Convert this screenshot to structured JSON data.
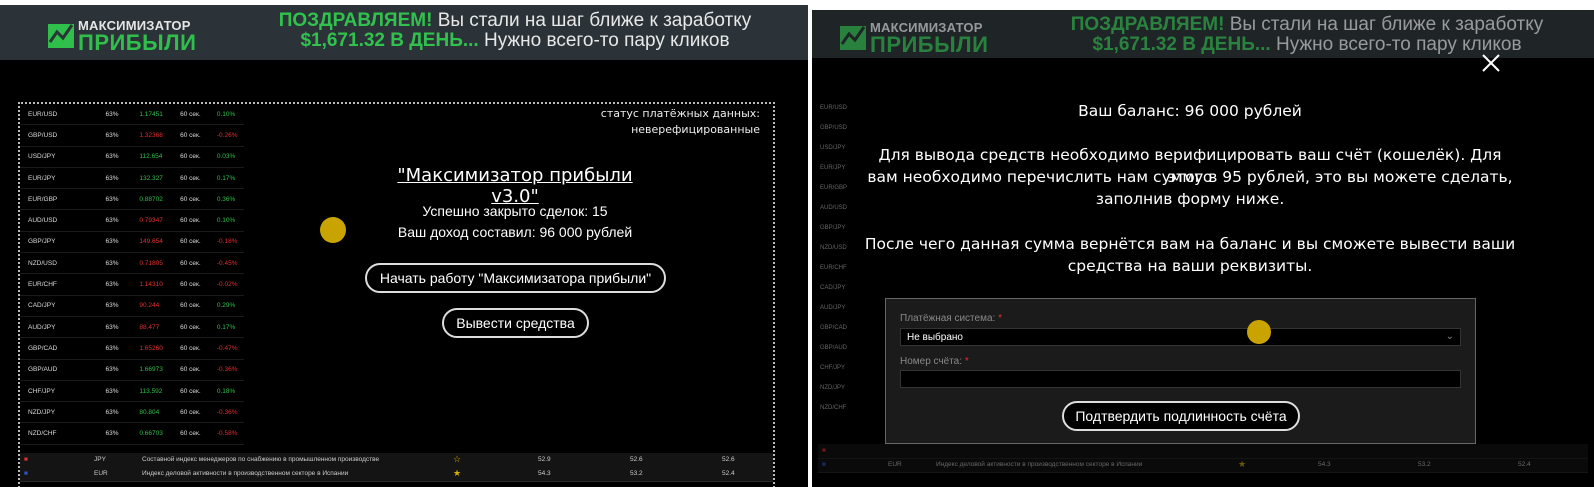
{
  "banner": {
    "logo_line1": "МАКСИМИЗАТОР",
    "logo_line2": "ПРИБЫЛИ",
    "headline_green1": "ПОЗДРАВЛЯЕМ!",
    "headline_white1": " Вы стали на шаг ближе к заработку",
    "headline_green2": "$1,671.32 В ДЕНЬ...",
    "headline_white2": " Нужно всего-то пару кликов"
  },
  "ticker": [
    {
      "pair": "EUR/USD",
      "pct": "63%",
      "value": "1.17451",
      "dur": "60 сек.",
      "change": "0.10%",
      "dir": "up"
    },
    {
      "pair": "GBP/USD",
      "pct": "63%",
      "value": "1.32368",
      "dur": "60 сек.",
      "change": "-0.26%",
      "dir": "dn"
    },
    {
      "pair": "USD/JPY",
      "pct": "63%",
      "value": "112.654",
      "dur": "60 сек.",
      "change": "0.03%",
      "dir": "up"
    },
    {
      "pair": "EUR/JPY",
      "pct": "63%",
      "value": "132.327",
      "dur": "60 сек.",
      "change": "0.17%",
      "dir": "up"
    },
    {
      "pair": "EUR/GBP",
      "pct": "63%",
      "value": "0.88702",
      "dur": "60 сек.",
      "change": "0.36%",
      "dir": "up"
    },
    {
      "pair": "AUD/USD",
      "pct": "63%",
      "value": "0.79347",
      "dur": "60 сек.",
      "change": "0.10%",
      "dir": "dn"
    },
    {
      "pair": "GBP/JPY",
      "pct": "63%",
      "value": "149.654",
      "dur": "60 сек.",
      "change": "-0.18%",
      "dir": "dn"
    },
    {
      "pair": "NZD/USD",
      "pct": "63%",
      "value": "0.71805",
      "dur": "60 сек.",
      "change": "-0.45%",
      "dir": "dn"
    },
    {
      "pair": "EUR/CHF",
      "pct": "63%",
      "value": "1.14310",
      "dur": "60 сек.",
      "change": "-0.02%",
      "dir": "dn"
    },
    {
      "pair": "CAD/JPY",
      "pct": "63%",
      "value": "90.244",
      "dur": "60 сек.",
      "change": "0.29%",
      "dir": "dn"
    },
    {
      "pair": "AUD/JPY",
      "pct": "63%",
      "value": "88.477",
      "dur": "60 сек.",
      "change": "0.17%",
      "dir": "dn"
    },
    {
      "pair": "GBP/CAD",
      "pct": "63%",
      "value": "1.65260",
      "dur": "60 сек.",
      "change": "-0.47%",
      "dir": "dn"
    },
    {
      "pair": "GBP/AUD",
      "pct": "63%",
      "value": "1.66973",
      "dur": "60 сек.",
      "change": "-0.36%",
      "dir": "up"
    },
    {
      "pair": "CHF/JPY",
      "pct": "63%",
      "value": "113.592",
      "dur": "60 сек.",
      "change": "0.18%",
      "dir": "up"
    },
    {
      "pair": "NZD/JPY",
      "pct": "63%",
      "value": "80.804",
      "dur": "60 сек.",
      "change": "-0.36%",
      "dir": "up"
    },
    {
      "pair": "NZD/CHF",
      "pct": "63%",
      "value": "0.66703",
      "dur": "60 сек.",
      "change": "-0.58%",
      "dir": "up"
    }
  ],
  "status": {
    "line1": "статус платёжных данных:",
    "line2": "неверефицированные"
  },
  "main": {
    "title": "\"Максимизатор прибыли v3.0\"",
    "deals": "Успешно закрыто сделок: 15",
    "income": "Ваш доход составил: 96 000 рублей",
    "start_button": "Начать работу \"Максимизатора прибыли\"",
    "withdraw_button": "Вывести средства"
  },
  "news": [
    {
      "cur": "JPY",
      "text": "Составной индекс менеджеров по снабжению в промышленном производстве",
      "a": "52.9",
      "b": "52.6",
      "c": "52.6"
    },
    {
      "cur": "EUR",
      "text": "Индекс деловой активности в производственном секторе в Испании",
      "a": "54.3",
      "b": "53.2",
      "c": "52.4"
    }
  ],
  "modal": {
    "balance": "Ваш баланс: 96 000 рублей",
    "p1_l1": "Для вывода средств необходимо верифицировать ваш счёт (кошелёк). Для этого",
    "p1_l2": "вам необходимо перечислить нам сумму в 95 рублей, это вы можете сделать,",
    "p1_l3": "заполнив форму ниже.",
    "p2_l1": "После чего данная сумма вернётся вам на баланс и вы сможете вывести ваши",
    "p2_l2": "средства на ваши реквизиты.",
    "payment_label": "Платёжная система:",
    "payment_value": "Не выбрано",
    "account_label": "Номер счёта:",
    "account_value": "",
    "required_mark": "*",
    "confirm_button": "Подтвердить подлинность счёта"
  },
  "colors": {
    "green": "#2fbf4a",
    "red": "#e03030",
    "banner": "#2b3338",
    "cursor": "#c9a400"
  }
}
